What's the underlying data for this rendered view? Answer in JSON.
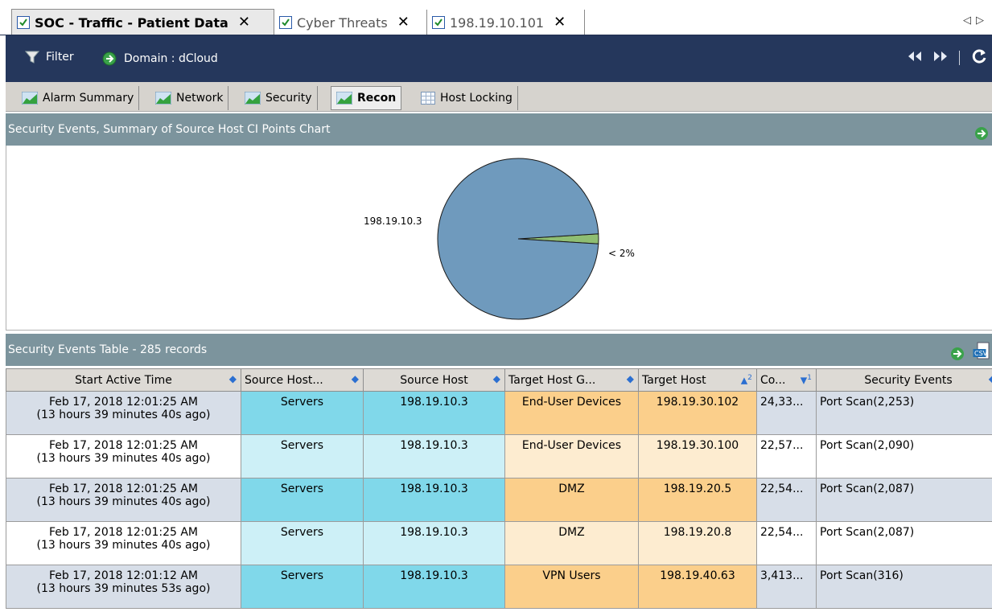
{
  "doc_tabs": [
    {
      "label": "SOC - Traffic - Patient Data",
      "active": true
    },
    {
      "label": "Cyber Threats",
      "active": false
    },
    {
      "label": "198.19.10.101",
      "active": false
    }
  ],
  "toolbar": {
    "filter_label": "Filter",
    "domain_label": "Domain : dCloud"
  },
  "view_tabs": [
    {
      "label": "Alarm Summary"
    },
    {
      "label": "Network"
    },
    {
      "label": "Security"
    },
    {
      "label": "Recon"
    },
    {
      "label": "Host Locking"
    }
  ],
  "chart_panel": {
    "title": "Security Events, Summary of Source Host CI Points Chart"
  },
  "chart_data": {
    "type": "pie",
    "slices": [
      {
        "label": "198.19.10.3",
        "value": 98,
        "color": "#6f9abd"
      },
      {
        "label": "< 2%",
        "value": 2,
        "color": "#8fbe72"
      }
    ]
  },
  "table_panel": {
    "title": "Security Events Table - 285 records"
  },
  "table": {
    "columns": [
      "Start Active Time",
      "Source Host...",
      "Source Host",
      "Target Host G...",
      "Target Host",
      "Co...",
      "Security Events"
    ],
    "sort_markers": {
      "target_host": "2",
      "count": "1"
    },
    "rows": [
      {
        "time": "Feb 17, 2018 12:01:25 AM",
        "ago": "(13 hours 39 minutes 40s ago)",
        "src_group": "Servers",
        "src_host": "198.19.10.3",
        "tgt_group": "End-User Devices",
        "tgt_host": "198.19.30.102",
        "count": "24,33...",
        "events": "Port Scan(2,253)"
      },
      {
        "time": "Feb 17, 2018 12:01:25 AM",
        "ago": "(13 hours 39 minutes 40s ago)",
        "src_group": "Servers",
        "src_host": "198.19.10.3",
        "tgt_group": "End-User Devices",
        "tgt_host": "198.19.30.100",
        "count": "22,57...",
        "events": "Port Scan(2,090)"
      },
      {
        "time": "Feb 17, 2018 12:01:25 AM",
        "ago": "(13 hours 39 minutes 40s ago)",
        "src_group": "Servers",
        "src_host": "198.19.10.3",
        "tgt_group": "DMZ",
        "tgt_host": "198.19.20.5",
        "count": "22,54...",
        "events": "Port Scan(2,087)"
      },
      {
        "time": "Feb 17, 2018 12:01:25 AM",
        "ago": "(13 hours 39 minutes 40s ago)",
        "src_group": "Servers",
        "src_host": "198.19.10.3",
        "tgt_group": "DMZ",
        "tgt_host": "198.19.20.8",
        "count": "22,54...",
        "events": "Port Scan(2,087)"
      },
      {
        "time": "Feb 17, 2018 12:01:12 AM",
        "ago": "(13 hours 39 minutes 53s ago)",
        "src_group": "Servers",
        "src_host": "198.19.10.3",
        "tgt_group": "VPN Users",
        "tgt_host": "198.19.40.63",
        "count": "3,413...",
        "events": "Port Scan(316)"
      }
    ]
  },
  "colors": {
    "toolbar_bg": "#25375c",
    "panel_header_bg": "#7c949d",
    "accent_green": "#3aa24a",
    "sort_blue": "#2b6fd1"
  }
}
